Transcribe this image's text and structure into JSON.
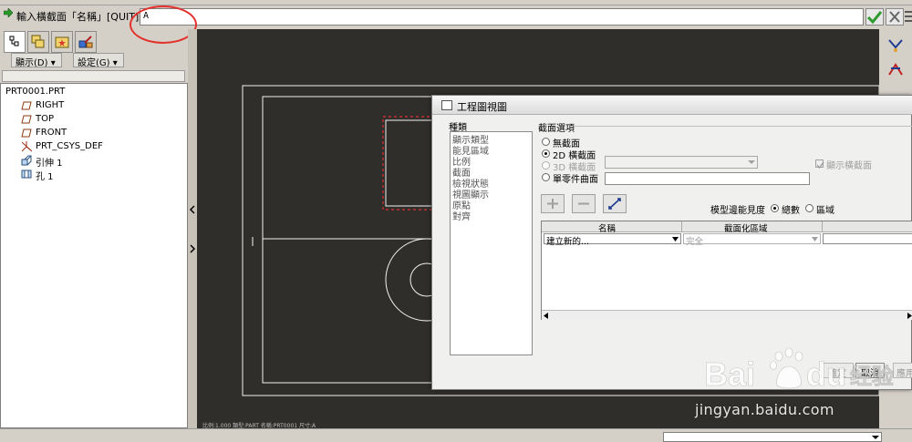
{
  "prompt": {
    "label": "輸入橫截面「名稱」[QUIT]:",
    "value": "A"
  },
  "left_panel": {
    "menus": [
      {
        "label": "顯示(D)"
      },
      {
        "label": "設定(G)"
      }
    ],
    "tree": [
      {
        "label": "PRT0001.PRT",
        "icon": "part-icon"
      },
      {
        "label": "RIGHT",
        "icon": "datum-plane-icon"
      },
      {
        "label": "TOP",
        "icon": "datum-plane-icon"
      },
      {
        "label": "FRONT",
        "icon": "datum-plane-icon"
      },
      {
        "label": "PRT_CSYS_DEF",
        "icon": "csys-icon"
      },
      {
        "label": "引伸 1",
        "icon": "extrude-icon"
      },
      {
        "label": "孔 1",
        "icon": "hole-icon"
      }
    ]
  },
  "graphics": {
    "status_text": "比例:1.000  類型:PART  名稱:PRT0001  尺寸:A"
  },
  "dialog": {
    "title": "工程圖視圖",
    "categories_label": "種類",
    "categories": [
      "顯示類型",
      "能見區域",
      "比例",
      "截面",
      "檢視狀態",
      "視圖顯示",
      "原點",
      "對齊"
    ],
    "section_options_label": "截面選項",
    "options": [
      {
        "label": "無截面",
        "selected": false,
        "enabled": true
      },
      {
        "label": "2D 橫截面",
        "selected": true,
        "enabled": true
      },
      {
        "label": "3D 橫截面",
        "selected": false,
        "enabled": false
      },
      {
        "label": "單零件曲面",
        "selected": false,
        "enabled": true
      }
    ],
    "show_xsec_label": "顯示橫截面",
    "model_edge_visibility_label": "模型邊能見度",
    "visibility_options": [
      {
        "label": "總數",
        "selected": true
      },
      {
        "label": "區域",
        "selected": false
      }
    ],
    "table": {
      "headers": [
        "名稱",
        "截面化區域"
      ],
      "row": {
        "name": "建立新的...",
        "area": "完全"
      }
    },
    "buttons": {
      "confirm": "確定",
      "cancel": "取消",
      "apply": "應用"
    }
  },
  "watermark": {
    "brand": "Bai du 经验",
    "url": "jingyan.baidu.com"
  },
  "colors": {
    "graphics_bg": "#2f2e2a",
    "highlight_red": "#e3312c",
    "ok_green": "#2f9a2f"
  }
}
